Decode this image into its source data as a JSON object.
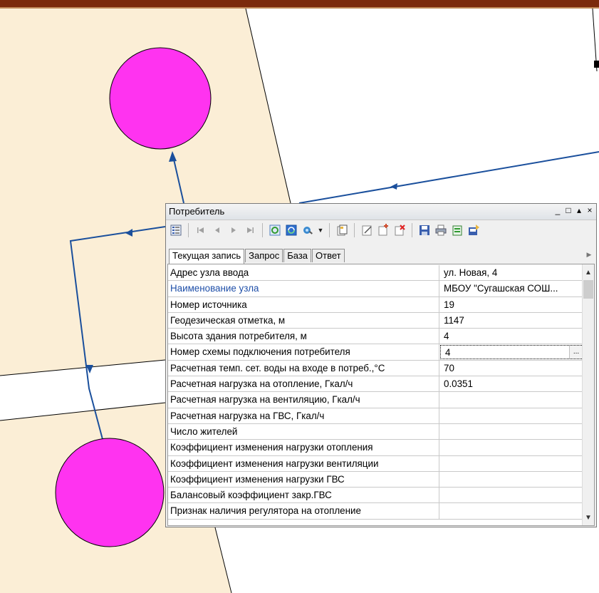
{
  "colors": {
    "map_bg": "#fbeed6",
    "node_fill": "#ff33f0",
    "pipe": "#1a4f9c",
    "street": "#ffffff"
  },
  "window": {
    "title": "Потребитель",
    "controls": [
      "_",
      "□",
      "▴",
      "×"
    ]
  },
  "toolbar": {
    "icons": [
      "record-menu-icon",
      "first-record-icon",
      "prev-record-icon",
      "next-record-icon",
      "last-record-icon",
      "refresh-icon",
      "sync-icon",
      "locate-icon",
      "new-record-icon",
      "edit-record-icon",
      "add-record-icon",
      "delete-record-icon",
      "save-icon",
      "print-icon",
      "export-excel-icon",
      "import-icon"
    ]
  },
  "tabs": [
    "Текущая запись",
    "Запрос",
    "База",
    "Ответ"
  ],
  "properties": [
    {
      "label": "Адрес узла ввода",
      "value": "ул. Новая, 4"
    },
    {
      "label": "Наименование узла",
      "value": "МБОУ \"Сугашская СОШ...",
      "link": true
    },
    {
      "label": "Номер источника",
      "value": "19"
    },
    {
      "label": "Геодезическая отметка, м",
      "value": "1147"
    },
    {
      "label": "Высота здания потребителя, м",
      "value": "4"
    },
    {
      "label": "Номер схемы подключения потребителя",
      "value": "4",
      "editing": true,
      "ellipsis": "..."
    },
    {
      "label": "Расчетная темп. сет. воды на входе в потреб.,°С",
      "value": "70"
    },
    {
      "label": "Расчетная нагрузка на отопление, Гкал/ч",
      "value": "0.0351"
    },
    {
      "label": "Расчетная нагрузка на вентиляцию, Гкал/ч",
      "value": ""
    },
    {
      "label": "Расчетная нагрузка на ГВС, Гкал/ч",
      "value": ""
    },
    {
      "label": "Число жителей",
      "value": ""
    },
    {
      "label": "Коэффициент изменения нагрузки отопления",
      "value": ""
    },
    {
      "label": "Коэффициент изменения нагрузки вентиляции",
      "value": ""
    },
    {
      "label": "Коэффициент изменения нагрузки ГВС",
      "value": ""
    },
    {
      "label": "Балансовый коэффициент закр.ГВС",
      "value": ""
    },
    {
      "label": "Признак наличия регулятора на отопление",
      "value": ""
    }
  ]
}
